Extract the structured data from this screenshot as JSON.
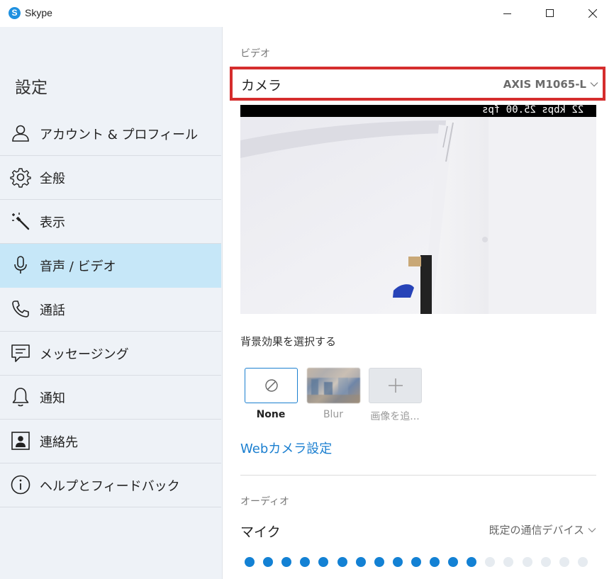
{
  "window": {
    "title": "Skype",
    "logo_glyph": "S",
    "icons": [
      "minimize-icon",
      "maximize-icon",
      "close-icon"
    ]
  },
  "sidebar": {
    "heading": "設定",
    "items": [
      {
        "label": "アカウント & プロフィール",
        "icon": "person-icon",
        "active": false
      },
      {
        "label": "全般",
        "icon": "gear-icon",
        "active": false
      },
      {
        "label": "表示",
        "icon": "magic-wand-icon",
        "active": false
      },
      {
        "label": "音声 / ビデオ",
        "icon": "microphone-icon",
        "active": true
      },
      {
        "label": "通話",
        "icon": "phone-icon",
        "active": false
      },
      {
        "label": "メッセージング",
        "icon": "message-icon",
        "active": false
      },
      {
        "label": "通知",
        "icon": "bell-icon",
        "active": false
      },
      {
        "label": "連絡先",
        "icon": "contact-card-icon",
        "active": false
      },
      {
        "label": "ヘルプとフィードバック",
        "icon": "info-icon",
        "active": false
      }
    ]
  },
  "video": {
    "section_label": "ビデオ",
    "camera_label": "カメラ",
    "camera_value": "AXIS M1065-L",
    "preview_osd": "22 kbps 25.00 fps",
    "background_title": "背景効果を選択する",
    "effects": [
      {
        "caption": "None",
        "selected": true
      },
      {
        "caption": "Blur",
        "selected": false
      },
      {
        "caption": "画像を追...",
        "selected": false
      }
    ],
    "webcam_settings_link": "Webカメラ設定"
  },
  "audio": {
    "section_label": "オーディオ",
    "mic_label": "マイク",
    "mic_value": "既定の通信デバイス",
    "level_total": 19,
    "level_active": 13
  },
  "colors": {
    "accent": "#1b7fd0",
    "active_nav": "#c6e7f8",
    "highlight_box": "#d52d2d",
    "sidebar_bg": "#eef2f7"
  }
}
